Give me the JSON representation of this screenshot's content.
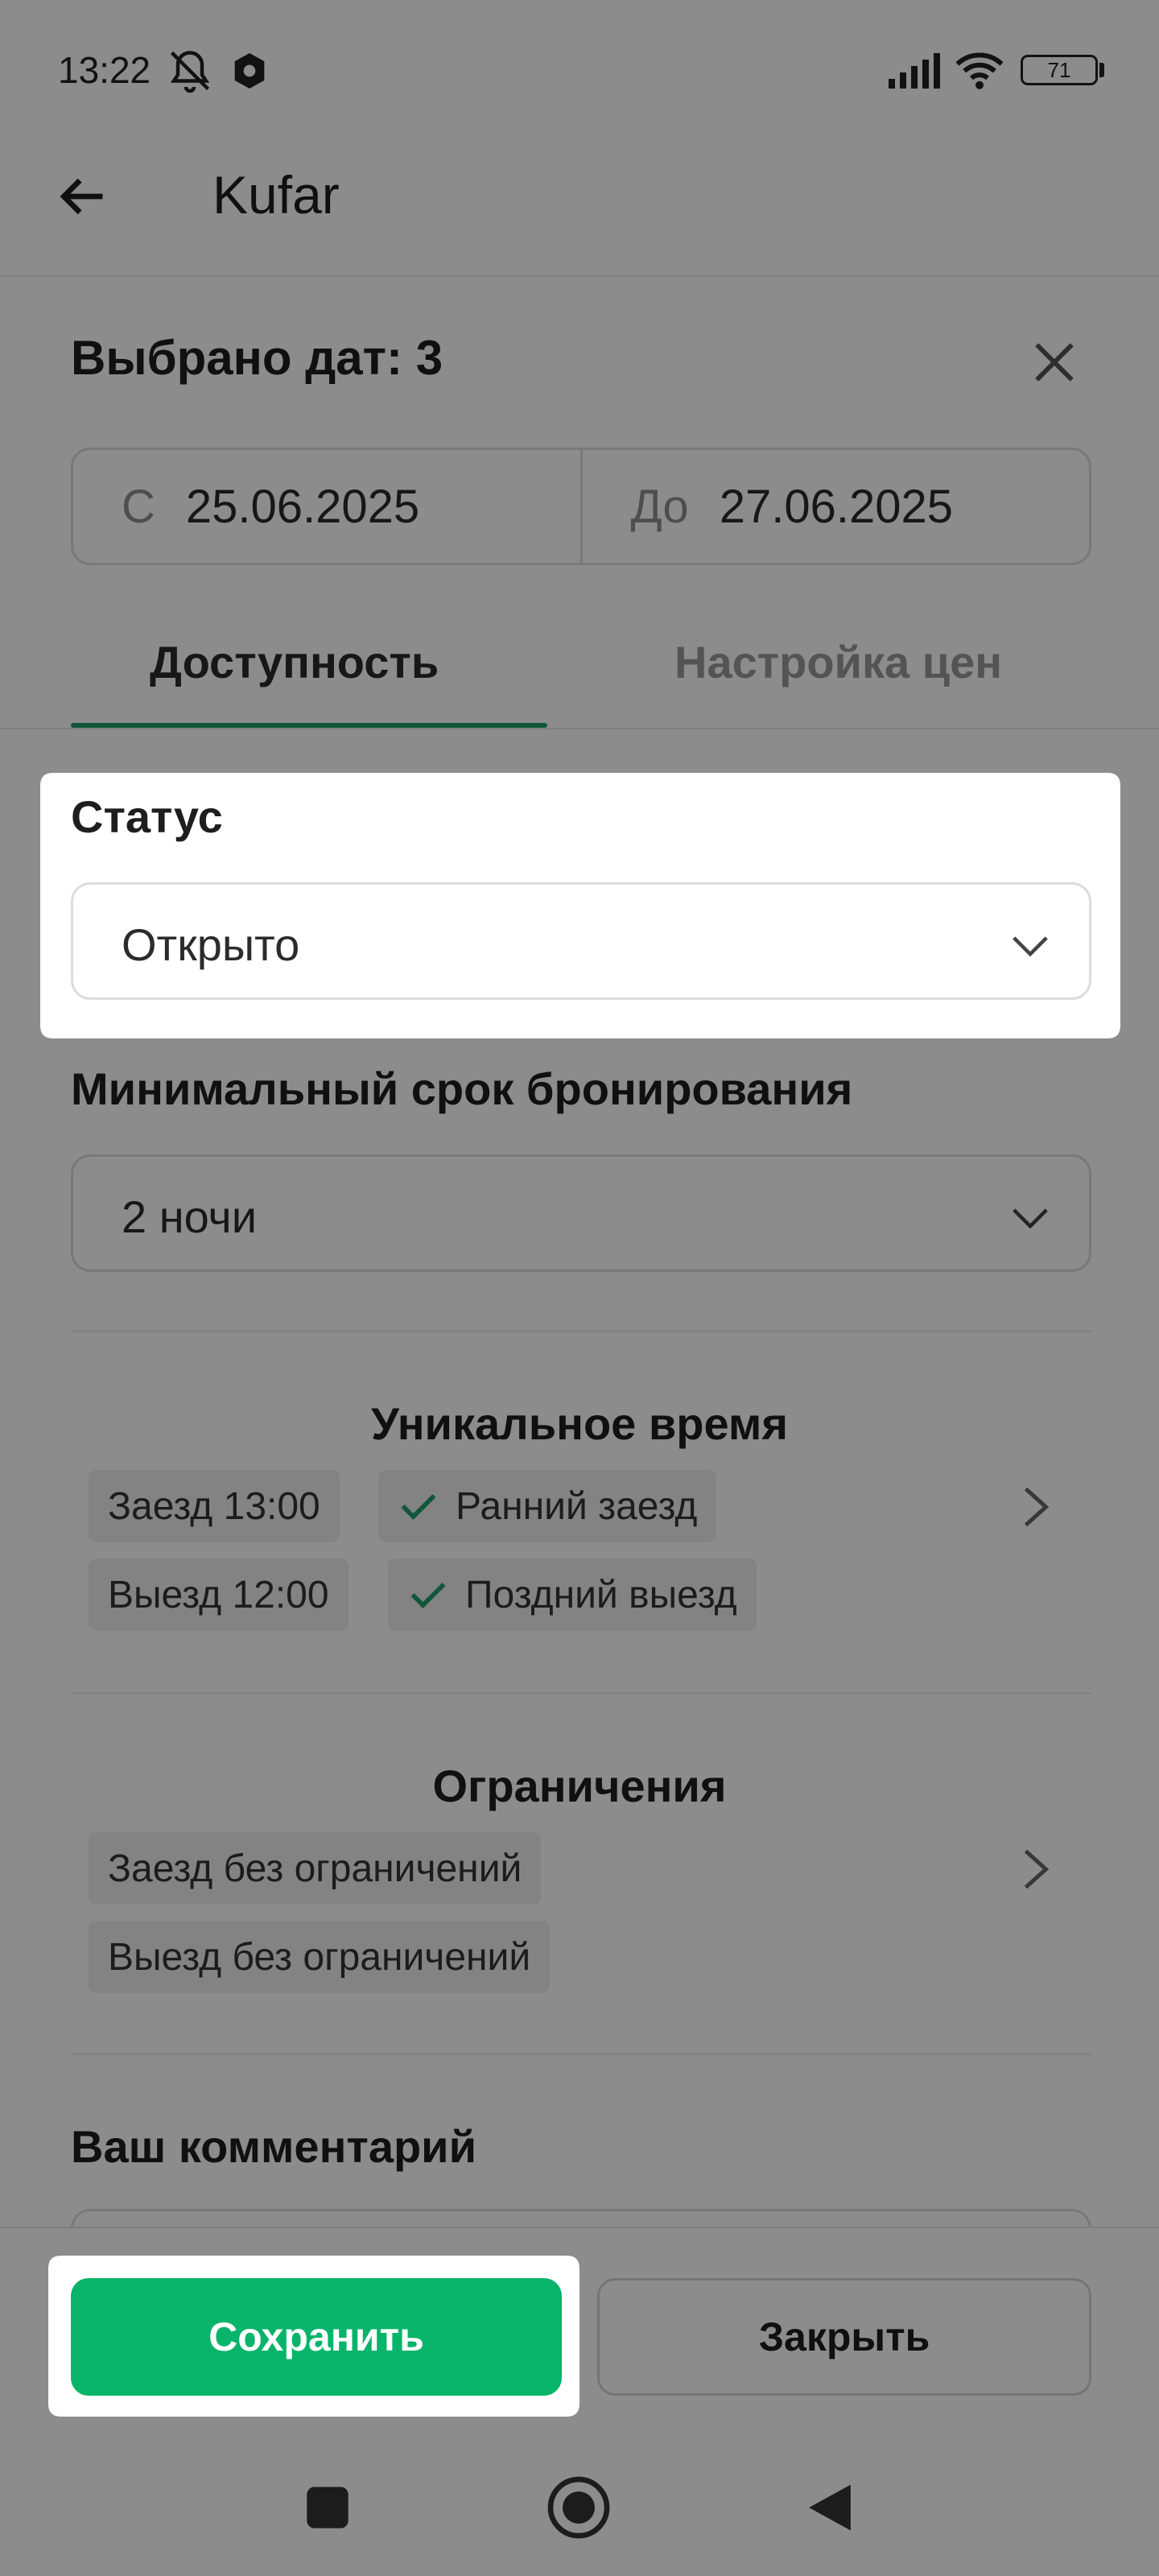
{
  "status_bar": {
    "time": "13:22",
    "battery": "71"
  },
  "app_bar": {
    "title": "Kufar"
  },
  "sheet": {
    "title": "Выбрано дат: 3",
    "date_from_prefix": "С",
    "date_from": "25.06.2025",
    "date_to_prefix": "До",
    "date_to": "27.06.2025"
  },
  "tabs": [
    {
      "label": "Доступность",
      "active": true
    },
    {
      "label": "Настройка цен",
      "active": false
    }
  ],
  "status": {
    "label": "Статус",
    "value": "Открыто"
  },
  "min_stay": {
    "label": "Минимальный срок бронирования",
    "value": "2 ночи"
  },
  "unique_time": {
    "title": "Уникальное время",
    "checkin": "Заезд 13:00",
    "early_checkin": "Ранний заезд",
    "checkout": "Выезд 12:00",
    "late_checkout": "Поздний выезд"
  },
  "restrictions": {
    "title": "Ограничения",
    "checkin": "Заезд без ограничений",
    "checkout": "Выезд без ограничений"
  },
  "comment": {
    "label": "Ваш комментарий"
  },
  "actions": {
    "save": "Сохранить",
    "close": "Закрыть"
  },
  "colors": {
    "accent_green": "#07b46a",
    "tab_indicator": "#1f9d6b",
    "overlay": "rgba(0,0,0,0.45)"
  }
}
